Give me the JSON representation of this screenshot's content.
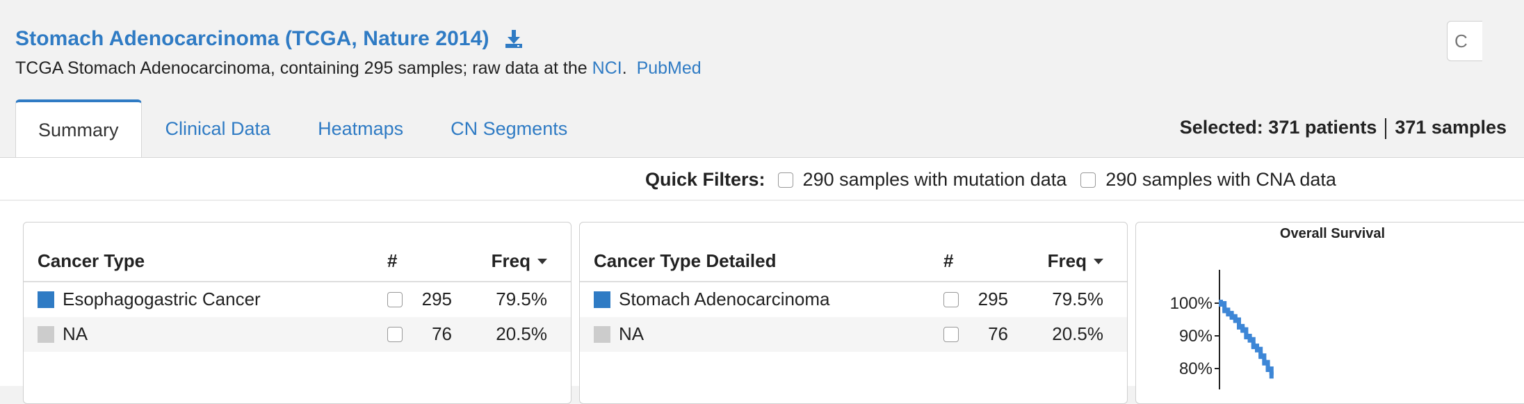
{
  "header": {
    "title": "Stomach Adenocarcinoma (TCGA, Nature 2014)",
    "description_prefix": "TCGA Stomach Adenocarcinoma, containing 295 samples; raw data at the ",
    "link_nci": "NCI",
    "description_mid": ".",
    "link_pubmed": "PubMed",
    "search_stub": "C"
  },
  "tabs": [
    {
      "label": "Summary",
      "active": true
    },
    {
      "label": "Clinical Data",
      "active": false
    },
    {
      "label": "Heatmaps",
      "active": false
    },
    {
      "label": "CN Segments",
      "active": false
    }
  ],
  "selected": {
    "label": "Selected:",
    "patients": "371 patients",
    "samples": "371 samples"
  },
  "quick_filters": {
    "label": "Quick Filters:",
    "items": [
      "290 samples with mutation data",
      "290 samples with CNA data"
    ]
  },
  "cancer_type_table": {
    "columns": [
      "Cancer Type",
      "#",
      "Freq"
    ],
    "rows": [
      {
        "name": "Esophagogastric Cancer",
        "count": "295",
        "freq": "79.5%",
        "color": "#2f7bc4"
      },
      {
        "name": "NA",
        "count": "76",
        "freq": "20.5%",
        "color": "#cccccc"
      }
    ]
  },
  "cancer_type_detailed_table": {
    "columns": [
      "Cancer Type Detailed",
      "#",
      "Freq"
    ],
    "rows": [
      {
        "name": "Stomach Adenocarcinoma",
        "count": "295",
        "freq": "79.5%",
        "color": "#2f7bc4"
      },
      {
        "name": "NA",
        "count": "76",
        "freq": "20.5%",
        "color": "#cccccc"
      }
    ]
  },
  "chart_data": {
    "type": "line",
    "title": "Overall Survival",
    "yticks": [
      "100%",
      "90%",
      "80%"
    ],
    "series": [
      {
        "x": [
          0,
          1,
          2,
          3,
          4,
          5,
          6,
          7,
          8,
          9,
          10,
          11,
          12,
          13,
          14
        ],
        "y": [
          100,
          98,
          97,
          96,
          95,
          93,
          92,
          90,
          89,
          87,
          86,
          84,
          82,
          80,
          78
        ]
      }
    ],
    "color": "#3d86d6"
  }
}
